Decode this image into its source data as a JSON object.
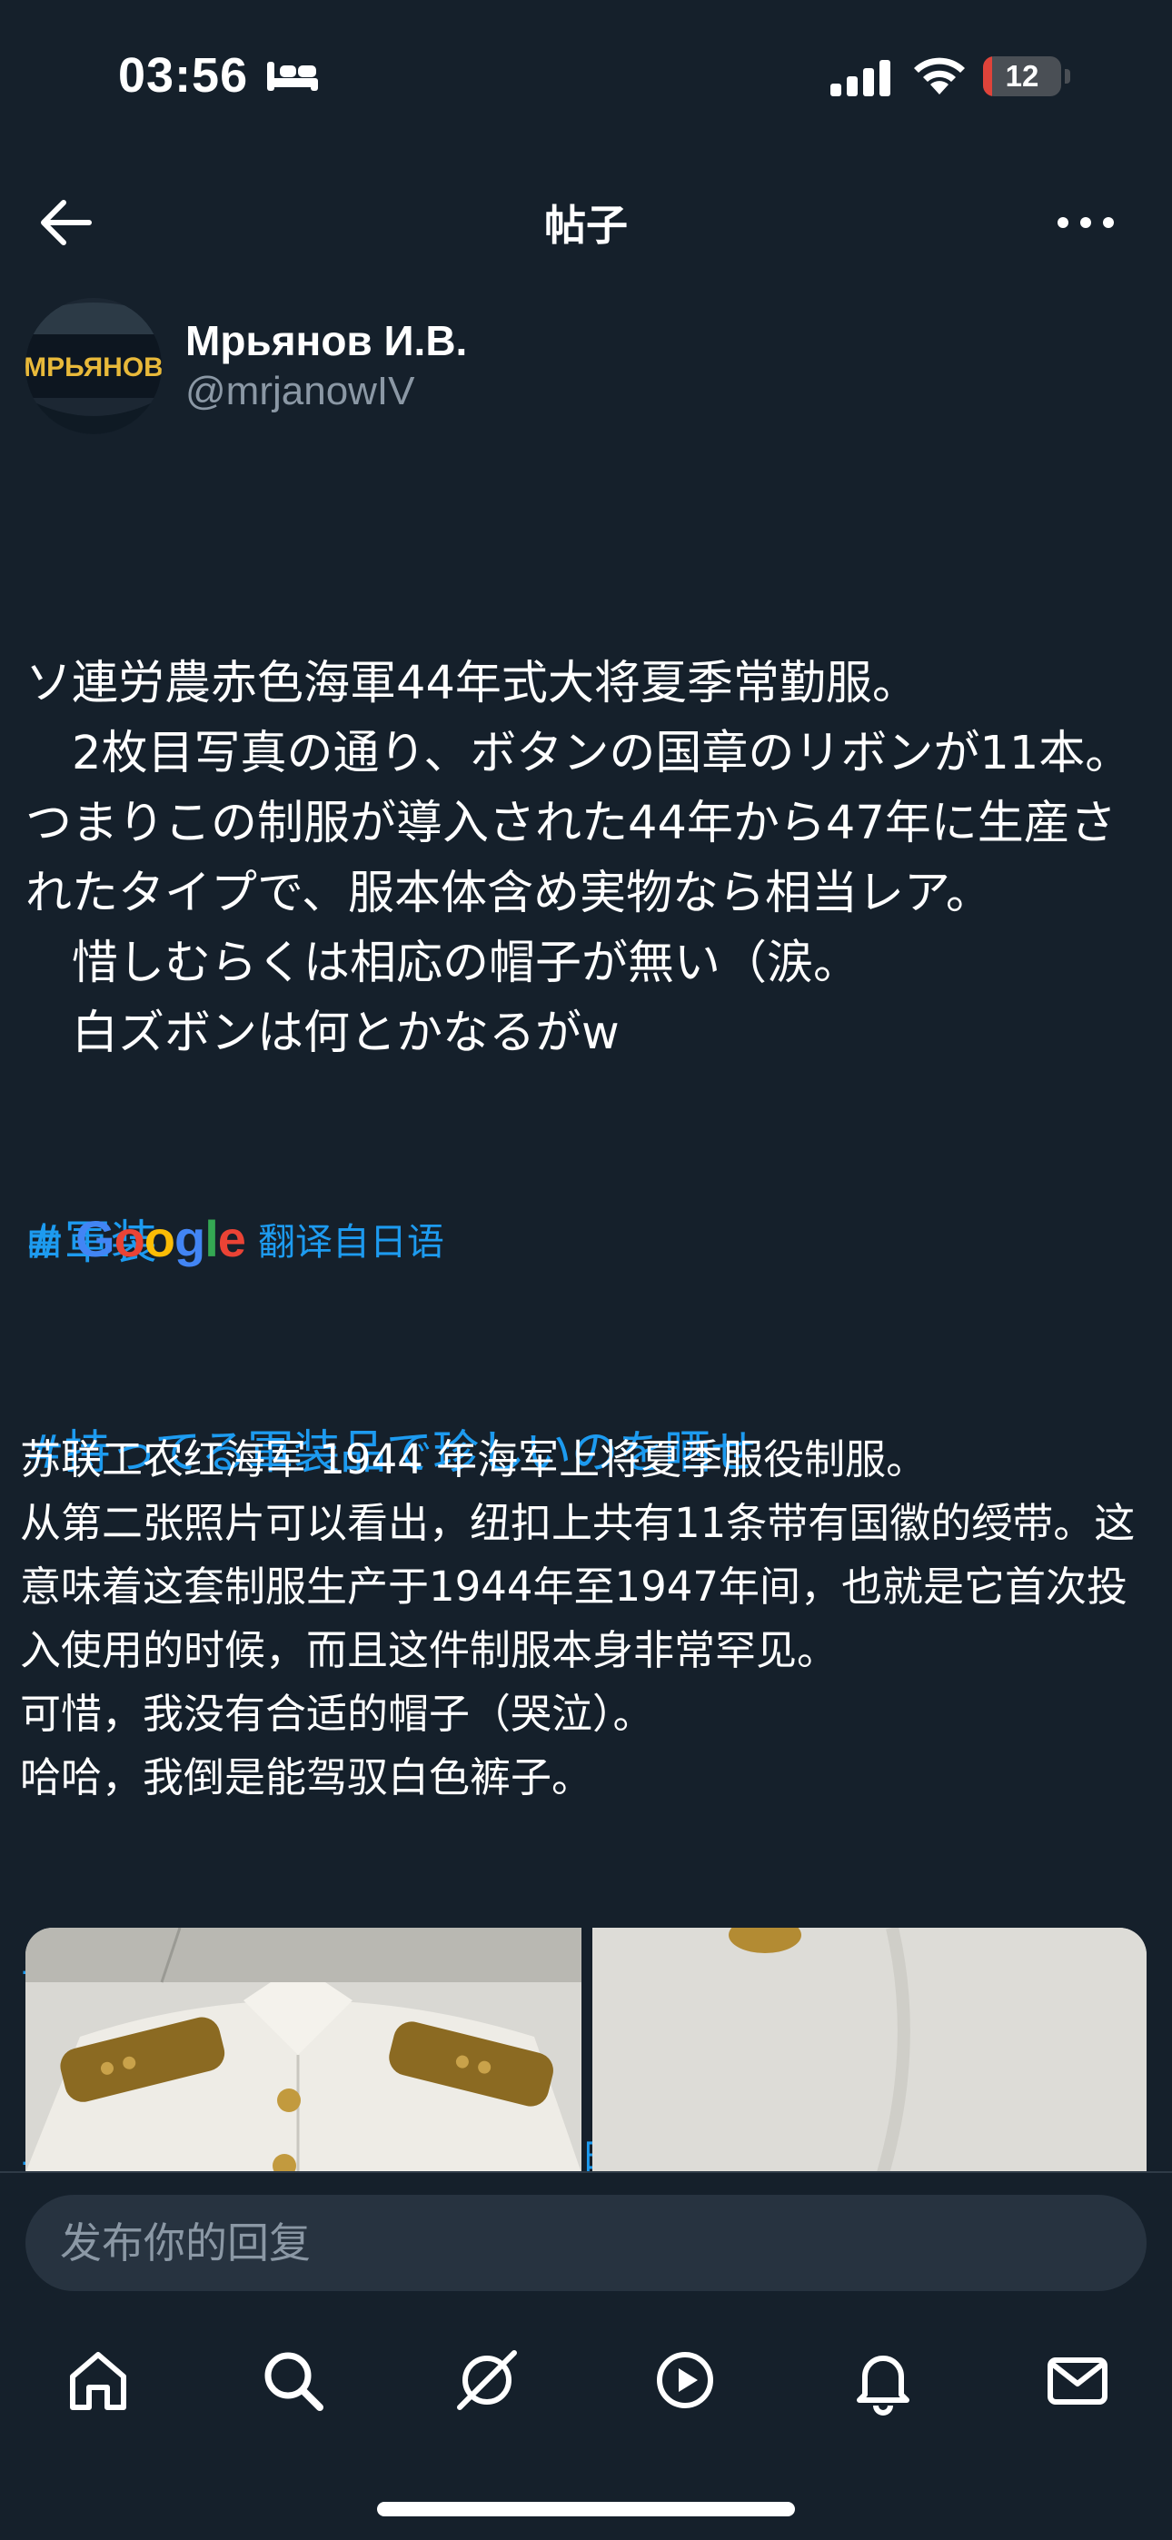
{
  "status_bar": {
    "time": "03:56",
    "battery_level": "12",
    "battery_fraction": 0.12,
    "battery_color": "#e0433a",
    "icons": [
      "sleep-icon",
      "signal-icon",
      "wifi-icon",
      "battery-icon"
    ]
  },
  "header": {
    "title": "帖子",
    "back_icon": "arrow-left-icon",
    "more_icon": "more-horizontal-icon"
  },
  "author": {
    "display_name": "Мрьянов И.В.",
    "handle": "@mrjanowIV",
    "avatar_text": "МРЬЯНОВ"
  },
  "post": {
    "text": "ソ連労農赤色海軍44年式大将夏季常勤服。\n　2枚目写真の通り、ボタンの国章のリボンが11本。つまりこの制服が導入された44年から47年に生産されたタイプで、服本体含め実物なら相当レア。\n　惜しむらくは相応の帽子が無い（涙。\n　白ズボンは何とかなるがw",
    "hashtags": [
      "#軍装",
      "#持ってる軍装品で珍しいのを晒せ"
    ]
  },
  "translation": {
    "prefix": "由",
    "provider": "Google",
    "suffix": "翻译自日语",
    "text": "苏联工农红海军 1944 年海军上将夏季服役制服。\n从第二张照片可以看出，纽扣上共有11条带有国徽的绶带。这意味着这套制服生产于1944年至1947年间，也就是它首次投入使用的时候，而且这件制服本身非常罕见。\n可惜，我没有合适的帽子（哭泣）。\n哈哈，我倒是能驾驭白色裤子。",
    "hashtags": [
      "#軍装",
      "#持ってる軍装品で珍しいのを晒せ"
    ]
  },
  "reply": {
    "placeholder": "发布你的回复"
  },
  "tab_bar": {
    "tabs": [
      "home-icon",
      "search-icon",
      "grok-icon",
      "video-icon",
      "notifications-icon",
      "messages-icon"
    ]
  },
  "colors": {
    "background": "#15202b",
    "accent": "#1d9bf0",
    "secondary_text": "#8b98a5"
  }
}
